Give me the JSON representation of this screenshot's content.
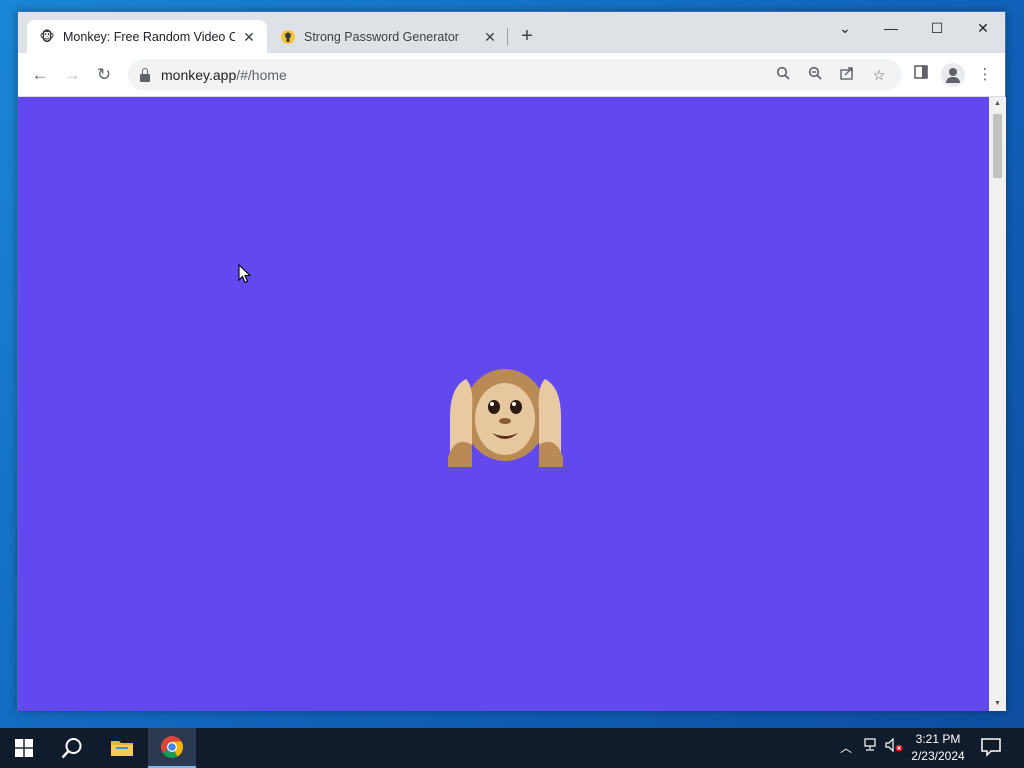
{
  "browser": {
    "tabs": [
      {
        "title": "Monkey: Free Random Video Ch",
        "favicon": "monkey-face-icon",
        "active": true
      },
      {
        "title": "Strong Password Generator",
        "favicon": "password-generator-icon",
        "active": false
      }
    ],
    "address": {
      "host": "monkey.app",
      "path": "/#/home"
    },
    "window_controls": [
      "tab-search-icon",
      "minimize-icon",
      "maximize-icon",
      "close-icon"
    ],
    "colors": {
      "page_background": "#6248ef",
      "tabstrip": "#dee1e6"
    }
  },
  "page": {
    "hero_emoji": "hear-no-evil-monkey-icon"
  },
  "taskbar": {
    "items": [
      "windows-start-icon",
      "search-icon",
      "file-explorer-icon",
      "chrome-icon"
    ],
    "clock": {
      "time": "3:21 PM",
      "date": "2/23/2024"
    }
  }
}
